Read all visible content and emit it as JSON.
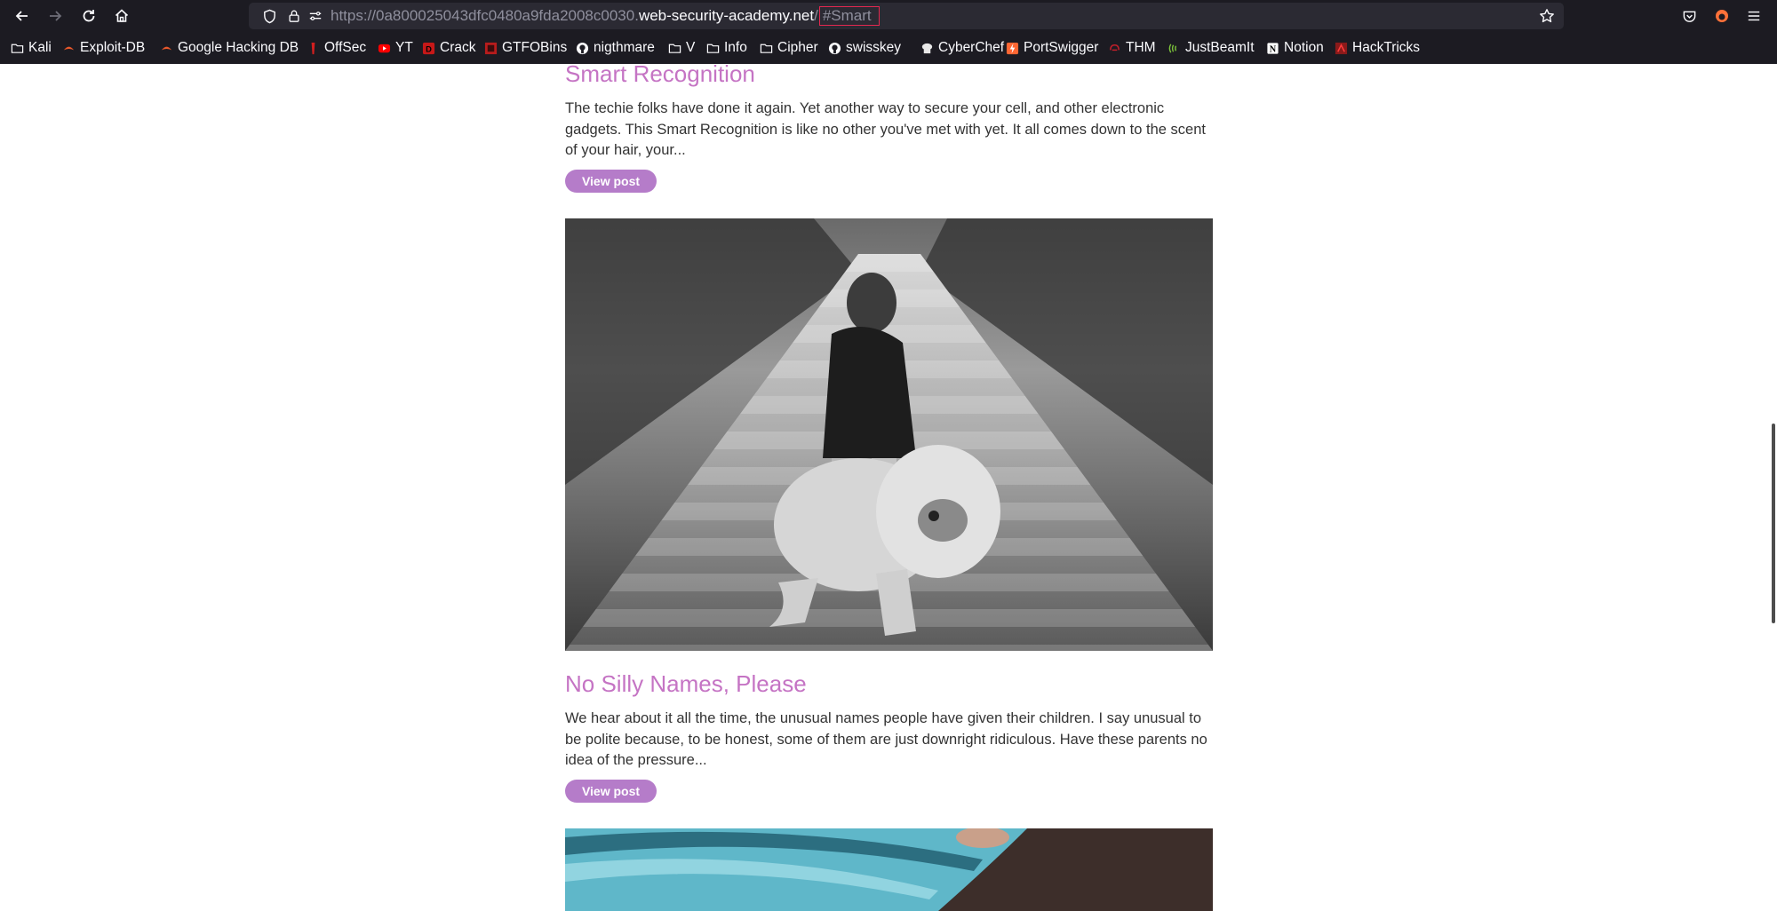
{
  "browser": {
    "url_prefix": "https://0a800025043dfc0480a9fda2008c0030.",
    "url_domain": "web-security-academy.net",
    "url_slash": "/",
    "url_hash": "#Smart"
  },
  "bookmarks": [
    {
      "label": "Kali",
      "icon": "folder-icon"
    },
    {
      "label": "Exploit-DB",
      "icon": "exploitdb-icon"
    },
    {
      "label": "Google Hacking DB",
      "icon": "exploitdb-icon"
    },
    {
      "label": "OffSec",
      "icon": "offsec-icon"
    },
    {
      "label": "YT",
      "icon": "youtube-icon"
    },
    {
      "label": "Crack",
      "icon": "crack-icon"
    },
    {
      "label": "GTFOBins",
      "icon": "gtfobins-icon"
    },
    {
      "label": "nigthmare",
      "icon": "github-icon"
    },
    {
      "label": "V",
      "icon": "folder-icon"
    },
    {
      "label": "Info",
      "icon": "folder-icon"
    },
    {
      "label": "Cipher",
      "icon": "folder-icon"
    },
    {
      "label": "swisskey",
      "icon": "github-icon"
    },
    {
      "label": "CyberChef",
      "icon": "cyberchef-icon"
    },
    {
      "label": "PortSwigger",
      "icon": "portswigger-icon"
    },
    {
      "label": "THM",
      "icon": "thm-icon"
    },
    {
      "label": "JustBeamIt",
      "icon": "justbeamit-icon"
    },
    {
      "label": "Notion",
      "icon": "notion-icon"
    },
    {
      "label": "HackTricks",
      "icon": "hacktricks-icon"
    }
  ],
  "posts": [
    {
      "title": "Smart Recognition",
      "excerpt": "The techie folks have done it again. Yet another way to secure your cell, and other electronic gadgets. This Smart Recognition is like no other you've met with yet. It all comes down to the scent of your hair, your...",
      "button": "View post"
    },
    {
      "title": "No Silly Names, Please",
      "excerpt": "We hear about it all the time, the unusual names people have given their children. I say unusual to be polite because, to be honest, some of them are just downright ridiculous. Have these parents no idea of the pressure...",
      "button": "View post"
    }
  ],
  "colors": {
    "title": "#c574c4",
    "button_bg": "#b57cc9",
    "chrome_bg": "#1c1b22",
    "hash_highlight": "#e22850"
  }
}
